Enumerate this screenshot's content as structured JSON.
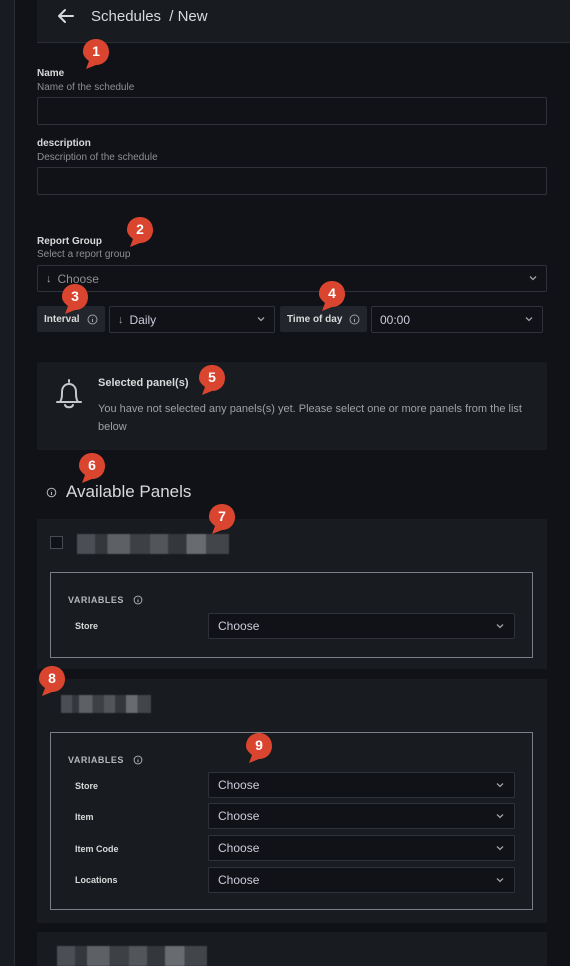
{
  "header": {
    "back_icon": "arrow-left-icon",
    "title": "Schedules",
    "subtitle": "/ New"
  },
  "form": {
    "name": {
      "label": "Name",
      "description": "Name of the schedule",
      "value": ""
    },
    "description": {
      "label": "description",
      "description": "Description of the schedule",
      "value": ""
    },
    "report_group": {
      "label": "Report Group",
      "description": "Select a report group",
      "value": "Choose"
    },
    "interval": {
      "label": "Interval",
      "value": "Daily"
    },
    "time_of_day": {
      "label": "Time of day",
      "value": "00:00"
    }
  },
  "selected_panels": {
    "title": "Selected panel(s)",
    "message": "You have not selected any panels(s) yet. Please select one or more panels from the list below"
  },
  "available_panels": {
    "title": "Available Panels",
    "cards": [
      {
        "variables_label": "VARIABLES",
        "variables": [
          {
            "name": "Store",
            "value": "Choose"
          }
        ]
      },
      {
        "variables_label": "VARIABLES",
        "variables": [
          {
            "name": "Store",
            "value": "Choose"
          },
          {
            "name": "Item",
            "value": "Choose"
          },
          {
            "name": "Item Code",
            "value": "Choose"
          },
          {
            "name": "Locations",
            "value": "Choose"
          }
        ]
      }
    ]
  },
  "markers": [
    "1",
    "2",
    "3",
    "4",
    "5",
    "6",
    "7",
    "8",
    "9"
  ],
  "colors": {
    "background": "#111217",
    "panel": "#181b1f",
    "border": "#2f3238",
    "marker": "#d9452f",
    "text": "#ccccdc"
  }
}
